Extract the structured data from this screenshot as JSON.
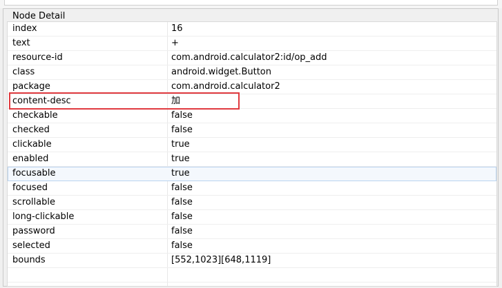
{
  "panel": {
    "title": "Node Detail"
  },
  "rows": [
    {
      "key": "index",
      "value": "16"
    },
    {
      "key": "text",
      "value": "+"
    },
    {
      "key": "resource-id",
      "value": "com.android.calculator2:id/op_add"
    },
    {
      "key": "class",
      "value": "android.widget.Button"
    },
    {
      "key": "package",
      "value": "com.android.calculator2"
    },
    {
      "key": "content-desc",
      "value": "加"
    },
    {
      "key": "checkable",
      "value": "false"
    },
    {
      "key": "checked",
      "value": "false"
    },
    {
      "key": "clickable",
      "value": "true"
    },
    {
      "key": "enabled",
      "value": "true"
    },
    {
      "key": "focusable",
      "value": "true"
    },
    {
      "key": "focused",
      "value": "false"
    },
    {
      "key": "scrollable",
      "value": "false"
    },
    {
      "key": "long-clickable",
      "value": "false"
    },
    {
      "key": "password",
      "value": "false"
    },
    {
      "key": "selected",
      "value": "false"
    },
    {
      "key": "bounds",
      "value": "[552,1023][648,1119]"
    }
  ],
  "colors": {
    "highlight_border": "#e0393e",
    "selected_row_bg": "#f4f8fd",
    "selected_row_border": "#b9d3ef"
  }
}
